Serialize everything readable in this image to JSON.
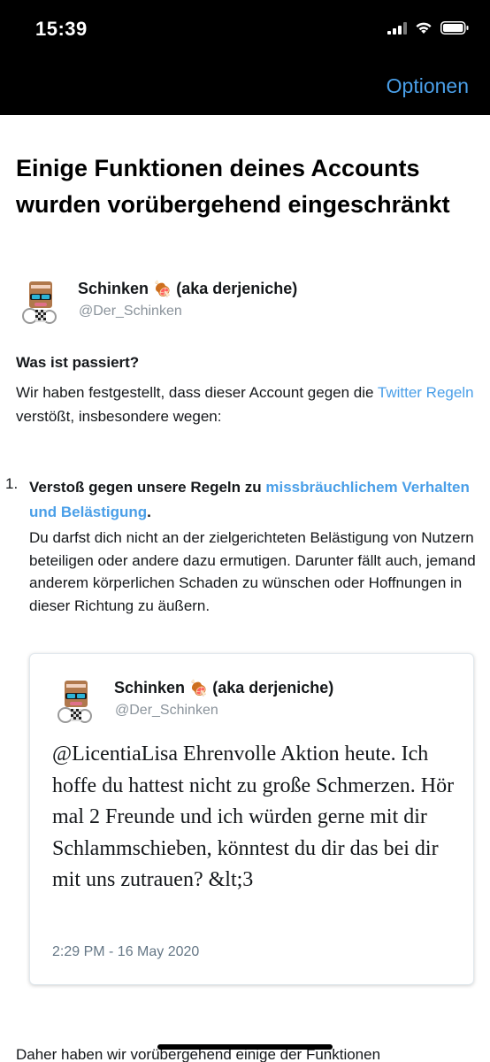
{
  "status_bar": {
    "time": "15:39",
    "icons": [
      "signal-icon",
      "wifi-icon",
      "battery-icon"
    ]
  },
  "nav": {
    "options_label": "Optionen"
  },
  "page": {
    "title": "Einige Funktionen deines Accounts wurden vorübergehend eingeschränkt"
  },
  "account": {
    "name": "Schinken",
    "name_suffix": "(aka derjeniche)",
    "emoji": "🍖",
    "handle": "@Der_Schinken"
  },
  "what_happened": {
    "title": "Was ist passiert?",
    "text_before_link": "Wir haben festgestellt, dass dieser Account gegen die",
    "link_label": "Twitter Regeln",
    "text_after_link": "verstößt, insbesondere wegen:"
  },
  "rule": {
    "number": "1.",
    "heading_start": "Verstoß gegen unsere Regeln zu",
    "heading_link": "missbräuchlichem Verhalten und Belästigung",
    "heading_end": ".",
    "description": "Du darfst dich nicht an der zielgerichteten Belästigung von Nutzern beteiligen oder andere dazu ermutigen. Darunter fällt auch, jemand anderem körperlichen Schaden zu wünschen oder Hoffnungen in dieser Richtung zu äußern."
  },
  "tweet": {
    "name": "Schinken",
    "name_suffix": "(aka derjeniche)",
    "emoji": "🍖",
    "handle": "@Der_Schinken",
    "text": "@LicentiaLisa Ehrenvolle Aktion heute. Ich hoffe du hattest nicht zu große Schmerzen. Hör mal 2 Freunde und ich würden gerne mit dir Schlammschieben, könntest du dir das bei dir mit uns zutrauen? &lt;3",
    "timestamp": "2:29 PM - 16 May 2020"
  },
  "footer": {
    "partial_text": "Daher haben wir vorübergehend einige der Funktionen"
  },
  "colors": {
    "link": "#4a9fe8",
    "text": "#14171a",
    "muted": "#8a939b"
  }
}
